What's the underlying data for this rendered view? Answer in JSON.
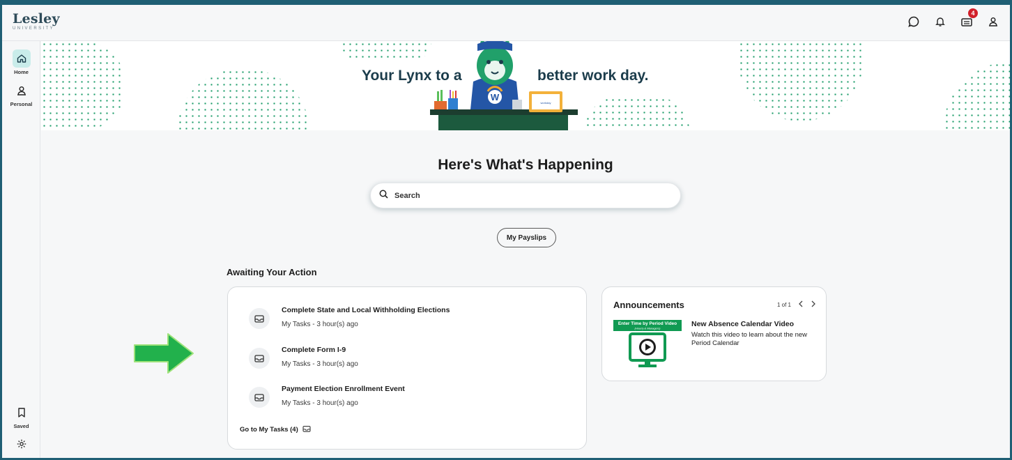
{
  "brand": {
    "name": "Lesley",
    "sub": "UNIVERSITY"
  },
  "topbar": {
    "icons": [
      "chat-icon",
      "bell-icon",
      "inbox-icon",
      "user-icon"
    ],
    "inbox_badge": "4"
  },
  "rail": {
    "items": [
      {
        "label": "Home",
        "icon": "home-icon",
        "active": true
      },
      {
        "label": "Personal",
        "icon": "person-icon",
        "active": false
      }
    ],
    "bottom": [
      {
        "label": "Saved",
        "icon": "bookmark-icon"
      },
      {
        "label": "",
        "icon": "gear-icon"
      }
    ]
  },
  "banner": {
    "title_left": "Your Lynx to a",
    "title_right": "better work day.",
    "shirt_letter": "W",
    "laptop_text": "workday"
  },
  "main": {
    "headline": "Here's What's Happening",
    "search": {
      "placeholder": "Search"
    },
    "quick_action": "My Payslips"
  },
  "awaiting": {
    "title": "Awaiting Your Action",
    "tasks": [
      {
        "title": "Complete State and Local Withholding Elections",
        "sub": "My Tasks - 3 hour(s) ago"
      },
      {
        "title": "Complete Form I-9",
        "sub": "My Tasks - 3 hour(s) ago"
      },
      {
        "title": "Payment Election Enrollment Event",
        "sub": "My Tasks - 3 hour(s) ago"
      }
    ],
    "goto_label": "Go to My Tasks (4)"
  },
  "announcements": {
    "title": "Announcements",
    "pager": "1 of 1",
    "thumb_title": "Enter Time by Period Video",
    "thumb_sub": "(Hourly & Managers)",
    "item_title": "New Absence Calendar Video",
    "item_body": "Watch this video to learn about the new Period Calendar"
  },
  "colors": {
    "accent": "#1f5f74",
    "brand_green": "#1f9e6b",
    "badge": "#d1202a",
    "arrow": "#22b14c"
  }
}
